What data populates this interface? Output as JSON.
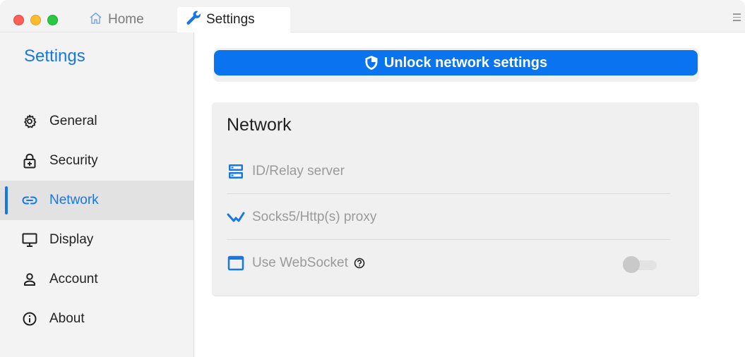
{
  "tabs": {
    "home_label": "Home",
    "settings_label": "Settings"
  },
  "sidebar": {
    "title": "Settings",
    "items": [
      {
        "label": "General",
        "icon": "gear-icon"
      },
      {
        "label": "Security",
        "icon": "lock-icon"
      },
      {
        "label": "Network",
        "icon": "link-icon",
        "active": true
      },
      {
        "label": "Display",
        "icon": "monitor-icon"
      },
      {
        "label": "Account",
        "icon": "person-icon"
      },
      {
        "label": "About",
        "icon": "info-icon"
      }
    ]
  },
  "main": {
    "unlock_label": "Unlock network settings",
    "card_title": "Network",
    "rows": [
      {
        "label": "ID/Relay server",
        "icon": "server-icon"
      },
      {
        "label": "Socks5/Http(s) proxy",
        "icon": "proxy-icon"
      },
      {
        "label": "Use WebSocket",
        "icon": "window-icon",
        "toggle": false
      }
    ]
  },
  "colors": {
    "accent": "#1677e6",
    "button": "#0a74f0"
  }
}
